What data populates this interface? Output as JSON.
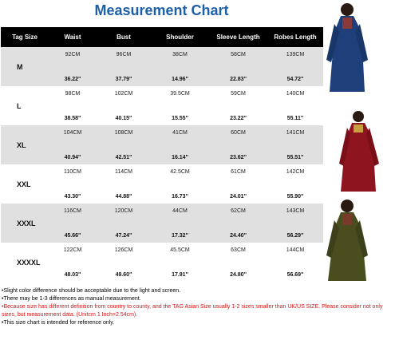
{
  "title": "Measurement Chart",
  "headers": [
    "Tag Size",
    "Waist",
    "Bust",
    "Shoulder",
    "Sleeve Length",
    "Robes Length"
  ],
  "rows": [
    {
      "size": "M",
      "cells": [
        {
          "cm": "92CM",
          "in": "36.22''"
        },
        {
          "cm": "96CM",
          "in": "37.79''"
        },
        {
          "cm": "38CM",
          "in": "14.96''"
        },
        {
          "cm": "58CM",
          "in": "22.83''"
        },
        {
          "cm": "139CM",
          "in": "54.72''"
        }
      ]
    },
    {
      "size": "L",
      "cells": [
        {
          "cm": "98CM",
          "in": "38.58''"
        },
        {
          "cm": "102CM",
          "in": "40.15''"
        },
        {
          "cm": "39.5CM",
          "in": "15.55''"
        },
        {
          "cm": "59CM",
          "in": "23.22''"
        },
        {
          "cm": "140CM",
          "in": "55.11''"
        }
      ]
    },
    {
      "size": "XL",
      "cells": [
        {
          "cm": "104CM",
          "in": "40.94''"
        },
        {
          "cm": "108CM",
          "in": "42.51''"
        },
        {
          "cm": "41CM",
          "in": "16.14''"
        },
        {
          "cm": "60CM",
          "in": "23.62''"
        },
        {
          "cm": "141CM",
          "in": "55.51''"
        }
      ]
    },
    {
      "size": "XXL",
      "cells": [
        {
          "cm": "110CM",
          "in": "43.30''"
        },
        {
          "cm": "114CM",
          "in": "44.88''"
        },
        {
          "cm": "42.5CM",
          "in": "16.73''"
        },
        {
          "cm": "61CM",
          "in": "24.01''"
        },
        {
          "cm": "142CM",
          "in": "55.90''"
        }
      ]
    },
    {
      "size": "XXXL",
      "cells": [
        {
          "cm": "116CM",
          "in": "45.66''"
        },
        {
          "cm": "120CM",
          "in": "47.24''"
        },
        {
          "cm": "44CM",
          "in": "17.32''"
        },
        {
          "cm": "62CM",
          "in": "24.40''"
        },
        {
          "cm": "143CM",
          "in": "56.29''"
        }
      ]
    },
    {
      "size": "XXXXL",
      "cells": [
        {
          "cm": "122CM",
          "in": "48.03''"
        },
        {
          "cm": "126CM",
          "in": "49.60''"
        },
        {
          "cm": "45.5CM",
          "in": "17.91''"
        },
        {
          "cm": "63CM",
          "in": "24.80''"
        },
        {
          "cm": "144CM",
          "in": "56.69''"
        }
      ]
    }
  ],
  "notes": [
    {
      "text": "•Slight color difference should be acceptable due to the light and screen.",
      "color": "#000000"
    },
    {
      "text": "•There may be 1-3 differences as manual measurement.",
      "color": "#000000"
    },
    {
      "text": "•Because size has different definition from country to county, and the TAG Asian Size usually 1-2 sizes smaller than UK/US SIZE. Please consider not only sizes, but measurement data. (Unitcm  1 Inch=2.54cm).",
      "color": "#dd1111"
    },
    {
      "text": "•This size chart is intended for reference only.",
      "color": "#000000"
    }
  ],
  "photo_colors": {
    "blue": "#1e3f7a",
    "red": "#8e1420",
    "green": "#4a4d1e"
  }
}
